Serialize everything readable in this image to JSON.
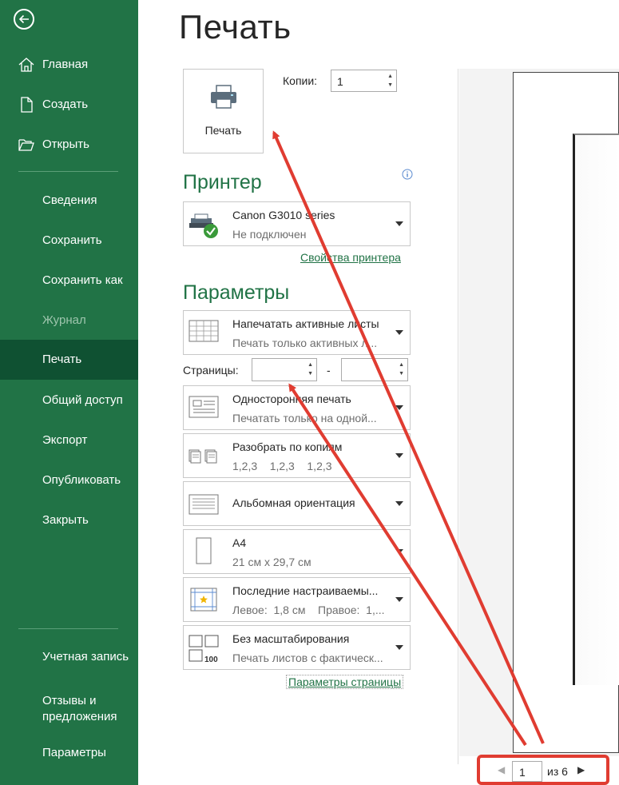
{
  "sidebar": {
    "items": [
      {
        "label": "Главная",
        "icon": "home-icon"
      },
      {
        "label": "Создать",
        "icon": "new-document-icon"
      },
      {
        "label": "Открыть",
        "icon": "folder-open-icon"
      },
      {
        "label": "Сведения"
      },
      {
        "label": "Сохранить"
      },
      {
        "label": "Сохранить как"
      },
      {
        "label": "Журнал"
      },
      {
        "label": "Печать"
      },
      {
        "label": "Общий доступ"
      },
      {
        "label": "Экспорт"
      },
      {
        "label": "Опубликовать"
      },
      {
        "label": "Закрыть"
      },
      {
        "label": "Учетная запись"
      },
      {
        "label": "Отзывы и предложения"
      },
      {
        "label": "Параметры"
      }
    ],
    "active": "Печать",
    "disabled": "Журнал",
    "accent": "#217346",
    "active_bg": "#0f5132"
  },
  "page_title": "Печать",
  "print_button": {
    "label": "Печать",
    "icon": "printer-icon"
  },
  "copies": {
    "label": "Копии:",
    "value": "1"
  },
  "printer": {
    "heading": "Принтер",
    "name": "Canon G3010 series",
    "status": "Не подключен",
    "properties_link": "Свойства принтера"
  },
  "settings": {
    "heading": "Параметры",
    "what_to_print": {
      "title": "Напечатать активные листы",
      "subtitle": "Печать только активных л..."
    },
    "pages": {
      "label": "Страницы:",
      "separator": "-",
      "from": "",
      "to": ""
    },
    "sides": {
      "title": "Односторонняя печать",
      "subtitle": "Печатать только на одной..."
    },
    "collation": {
      "title": "Разобрать по копиям",
      "subtitle": "1,2,3    1,2,3    1,2,3"
    },
    "orientation": {
      "title": "Альбомная ориентация"
    },
    "paper": {
      "title": "A4",
      "subtitle": "21 см x 29,7 см"
    },
    "margins": {
      "title": "Последние настраиваемы...",
      "subtitle": "Левое:  1,8 см    Правое:  1,..."
    },
    "scaling": {
      "title": "Без масштабирования",
      "subtitle": "Печать листов с фактическ..."
    },
    "page_setup_link": "Параметры страницы"
  },
  "preview_nav": {
    "current": "1",
    "total_text": "из 6"
  },
  "annotation_color": "#e03c31"
}
